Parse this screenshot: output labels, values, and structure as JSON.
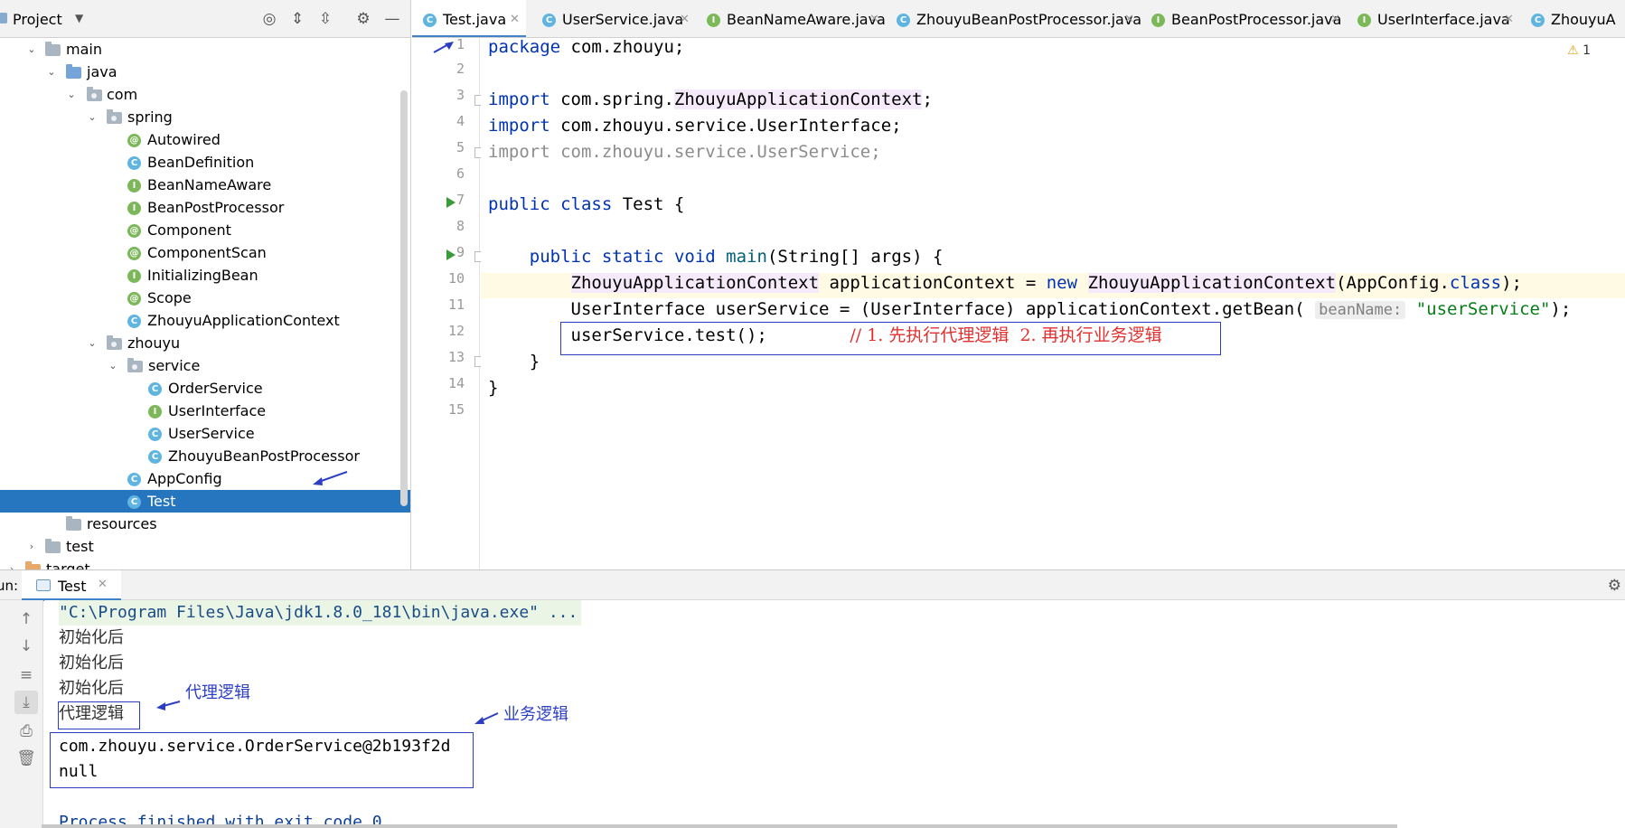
{
  "project": {
    "title": "Project",
    "tree": [
      {
        "label": "main",
        "kind": "folder",
        "depth": 0,
        "expanded": true
      },
      {
        "label": "java",
        "kind": "src",
        "depth": 1,
        "expanded": true
      },
      {
        "label": "com",
        "kind": "package",
        "depth": 2,
        "expanded": true
      },
      {
        "label": "spring",
        "kind": "package",
        "depth": 3,
        "expanded": true
      },
      {
        "label": "Autowired",
        "kind": "annotation",
        "depth": 4
      },
      {
        "label": "BeanDefinition",
        "kind": "class",
        "depth": 4
      },
      {
        "label": "BeanNameAware",
        "kind": "interface",
        "depth": 4
      },
      {
        "label": "BeanPostProcessor",
        "kind": "interface",
        "depth": 4
      },
      {
        "label": "Component",
        "kind": "annotation",
        "depth": 4
      },
      {
        "label": "ComponentScan",
        "kind": "annotation",
        "depth": 4
      },
      {
        "label": "InitializingBean",
        "kind": "interface",
        "depth": 4
      },
      {
        "label": "Scope",
        "kind": "annotation",
        "depth": 4
      },
      {
        "label": "ZhouyuApplicationContext",
        "kind": "class",
        "depth": 4
      },
      {
        "label": "zhouyu",
        "kind": "package",
        "depth": 3,
        "expanded": true
      },
      {
        "label": "service",
        "kind": "package",
        "depth": 4,
        "expanded": true
      },
      {
        "label": "OrderService",
        "kind": "class",
        "depth": 5
      },
      {
        "label": "UserInterface",
        "kind": "interface",
        "depth": 5
      },
      {
        "label": "UserService",
        "kind": "class",
        "depth": 5
      },
      {
        "label": "ZhouyuBeanPostProcessor",
        "kind": "class",
        "depth": 5
      },
      {
        "label": "AppConfig",
        "kind": "class",
        "depth": 4
      },
      {
        "label": "Test",
        "kind": "class",
        "depth": 4,
        "selected": true
      },
      {
        "label": "resources",
        "kind": "res",
        "depth": 1
      },
      {
        "label": "test",
        "kind": "folder",
        "depth": 0,
        "collapsed": true
      },
      {
        "label": "target",
        "kind": "target",
        "depth": -1,
        "collapsed": true
      }
    ]
  },
  "tabs": [
    {
      "label": "Test.java",
      "kind": "class",
      "active": true
    },
    {
      "label": "UserService.java",
      "kind": "class"
    },
    {
      "label": "BeanNameAware.java",
      "kind": "interface"
    },
    {
      "label": "ZhouyuBeanPostProcessor.java",
      "kind": "class"
    },
    {
      "label": "BeanPostProcessor.java",
      "kind": "interface"
    },
    {
      "label": "UserInterface.java",
      "kind": "interface"
    },
    {
      "label": "ZhouyuA",
      "kind": "class"
    }
  ],
  "editor": {
    "warning_count": "1",
    "line_numbers": [
      "1",
      "2",
      "3",
      "4",
      "5",
      "6",
      "7",
      "8",
      "9",
      "10",
      "11",
      "12",
      "13",
      "14",
      "15"
    ],
    "lines": {
      "l1": {
        "kw": "package",
        "rest": " com.zhouyu;"
      },
      "l3": {
        "kw": "import",
        "pre": " com.spring.",
        "cls": "ZhouyuApplicationContext",
        "post": ";"
      },
      "l4": {
        "kw": "import",
        "rest": " com.zhouyu.service.UserInterface;"
      },
      "l5": {
        "text": "import com.zhouyu.service.UserService;"
      },
      "l7": {
        "kw1": "public",
        "kw2": "class",
        "rest": " Test {"
      },
      "l9": {
        "indent": "    ",
        "kw1": "public",
        "kw2": "static",
        "kw3": "void",
        "method": "main",
        "rest": "(String[] args) {"
      },
      "l10": {
        "indent": "        ",
        "cls1": "ZhouyuApplicationContext",
        "mid": " applicationContext = ",
        "kw": "new",
        "sp": " ",
        "cls2": "ZhouyuApplicationContext",
        "tail1": "(AppConfig.",
        "kw2": "class",
        "tail2": ");"
      },
      "l11": {
        "indent": "        ",
        "pre": "UserInterface userService = (UserInterface) applicationContext.getBean( ",
        "hint": "beanName:",
        "str": " \"userService\"",
        "post": ");"
      },
      "l12": {
        "indent": "        ",
        "code": "userService.test();",
        "gap": "        ",
        "comment": "// 1. 先执行代理逻辑  2. 再执行业务逻辑"
      },
      "l13": {
        "text": "    }"
      },
      "l14": {
        "text": "}"
      }
    }
  },
  "run": {
    "label": "un:",
    "tab": "Test",
    "console": [
      "\"C:\\Program Files\\Java\\jdk1.8.0_181\\bin\\java.exe\" ...",
      "初始化后",
      "初始化后",
      "初始化后",
      "代理逻辑",
      "com.zhouyu.service.OrderService@2b193f2d",
      "null",
      "",
      "Process finished with exit code 0"
    ],
    "annotations": {
      "proxy": "代理逻辑",
      "business": "业务逻辑"
    }
  },
  "colors": {
    "keyword": "#0033b3",
    "string": "#067d17",
    "selection": "#2675bf",
    "annotation_blue": "#2c3fc2",
    "comment_red": "#e03030"
  }
}
